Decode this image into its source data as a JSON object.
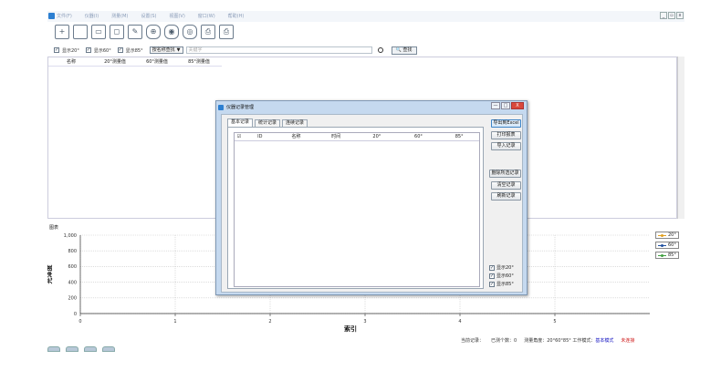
{
  "menu": [
    "文件(F)",
    "仪器(I)",
    "测量(M)",
    "设置(S)",
    "视图(V)",
    "窗口(W)",
    "帮助(H)"
  ],
  "window_controls": [
    "_",
    "▫",
    "x"
  ],
  "toolbar": {
    "icons": [
      "new-file-icon",
      "open-folder-icon",
      "save-icon",
      "device-icon",
      "measure-icon",
      "record-icon",
      "settings-icon",
      "search-icon",
      "print-icon",
      "print-preview-icon"
    ],
    "glyphs": [
      "+",
      "",
      "▭",
      "◻",
      "✎",
      "⊕",
      "◉",
      "◎",
      "⎙",
      "⎙"
    ]
  },
  "filter": {
    "show20": {
      "label": "显示20°",
      "checked": "✓"
    },
    "show60": {
      "label": "显示60°",
      "checked": "✓"
    },
    "show85": {
      "label": "显示85°",
      "checked": "✓"
    },
    "select_value": "按名称查找",
    "select_arrow": "▼",
    "keyword_placeholder": "关键字",
    "query_button": "🔍 查找"
  },
  "main_table": {
    "columns": [
      "名称",
      "20°测量值",
      "60°测量值",
      "85°测量值"
    ]
  },
  "chart_panel_title": "图表",
  "chart_data": {
    "type": "line",
    "ylabel": "光泽度",
    "xlabel": "索引",
    "x_ticks": [
      0,
      1,
      2,
      3,
      4,
      5
    ],
    "y_ticks": [
      0,
      200,
      400,
      600,
      800,
      "1,000"
    ],
    "xlim": [
      0,
      6
    ],
    "ylim": [
      0,
      1000
    ],
    "grid": true,
    "legend_position": "right",
    "series": [
      {
        "name": "20°",
        "color": "#e0a020",
        "values": []
      },
      {
        "name": "60°",
        "color": "#2050a0",
        "values": []
      },
      {
        "name": "85°",
        "color": "#40a040",
        "values": []
      }
    ]
  },
  "status": {
    "current_record": "当前记录：",
    "measured_count": "已测个数：0",
    "angle": "测量角度：20°60°85°",
    "mode_label": "工作模式：",
    "mode_value": "基本模式",
    "connection": "未连接",
    "colors": {
      "mode": "#1010c0",
      "connection": "#d02020"
    }
  },
  "dialog": {
    "title": "仪器记录管理",
    "controls": [
      "—",
      "□",
      "X"
    ],
    "tabs": [
      "基本记录",
      "统计记录",
      "连续记录"
    ],
    "table_columns": [
      "☑",
      "ID",
      "名称",
      "时间",
      "20°",
      "60°",
      "85°"
    ],
    "buttons": [
      "导出到Excel",
      "打印报表",
      "导入记录",
      "删除所选记录",
      "清空记录",
      "刷新记录"
    ],
    "checks": [
      {
        "label": "显示20°",
        "mark": "✓"
      },
      {
        "label": "显示60°",
        "mark": "✓"
      },
      {
        "label": "显示85°",
        "mark": "✓"
      }
    ]
  }
}
